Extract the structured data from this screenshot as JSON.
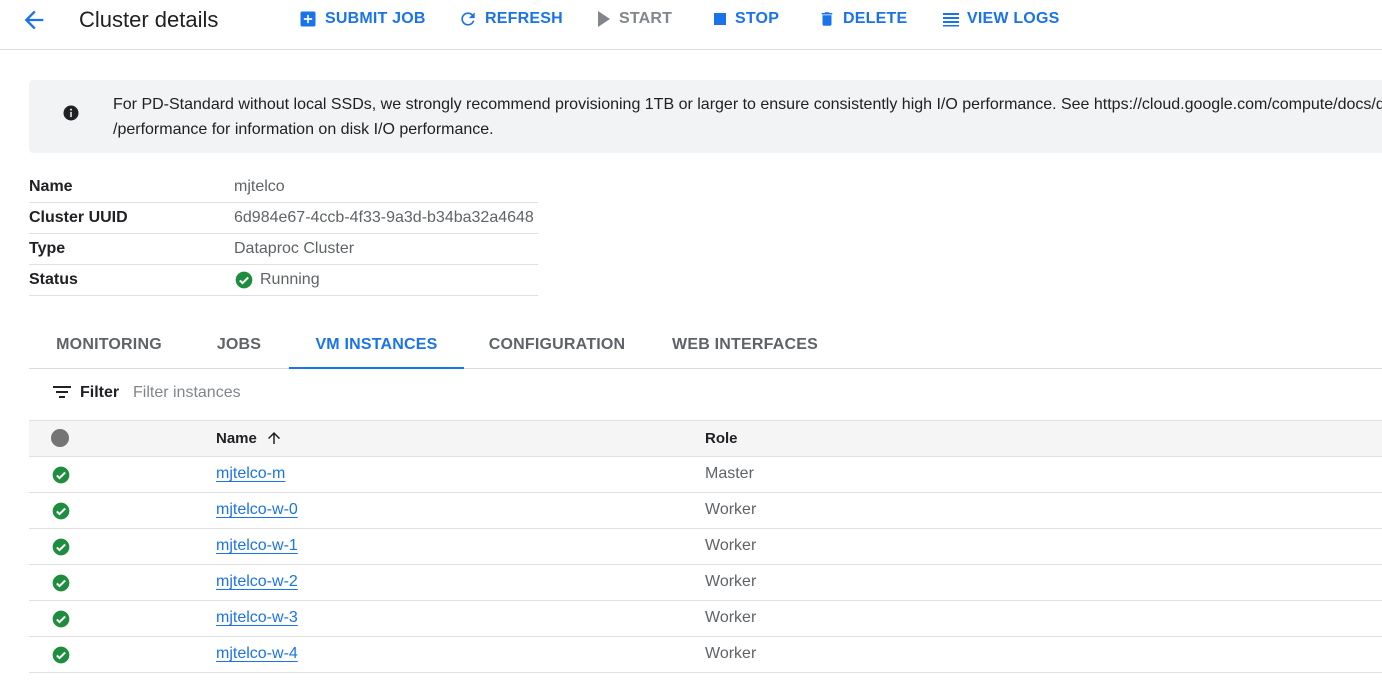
{
  "header": {
    "title": "Cluster details",
    "back_icon": "arrow-back-icon",
    "actions": {
      "submit_job": "SUBMIT JOB",
      "refresh": "REFRESH",
      "start": "START",
      "stop": "STOP",
      "delete": "DELETE",
      "view_logs": "VIEW LOGS"
    }
  },
  "banner": {
    "icon": "info-icon",
    "line1": "For PD-Standard without local SSDs, we strongly recommend provisioning 1TB or larger to ensure consistently high I/O performance. See https://cloud.google.com/compute/docs/disks",
    "line2": "/performance for information on disk I/O performance."
  },
  "details": {
    "name_label": "Name",
    "name_value": "mjtelco",
    "uuid_label": "Cluster UUID",
    "uuid_value": "6d984e67-4ccb-4f33-9a3d-b34ba32a4648",
    "type_label": "Type",
    "type_value": "Dataproc Cluster",
    "status_label": "Status",
    "status_value": "Running"
  },
  "tabs": {
    "monitoring": "MONITORING",
    "jobs": "JOBS",
    "vm_instances": "VM INSTANCES",
    "configuration": "CONFIGURATION",
    "web_interfaces": "WEB INTERFACES",
    "active": "vm_instances"
  },
  "filter": {
    "label": "Filter",
    "placeholder": "Filter instances"
  },
  "table": {
    "headers": {
      "name": "Name",
      "role": "Role"
    },
    "rows": [
      {
        "name": "mjtelco-m",
        "role": "Master"
      },
      {
        "name": "mjtelco-w-0",
        "role": "Worker"
      },
      {
        "name": "mjtelco-w-1",
        "role": "Worker"
      },
      {
        "name": "mjtelco-w-2",
        "role": "Worker"
      },
      {
        "name": "mjtelco-w-3",
        "role": "Worker"
      },
      {
        "name": "mjtelco-w-4",
        "role": "Worker"
      }
    ]
  },
  "colors": {
    "accent": "#1a73e8",
    "success": "#1e8e3e",
    "muted": "#5f6368"
  }
}
